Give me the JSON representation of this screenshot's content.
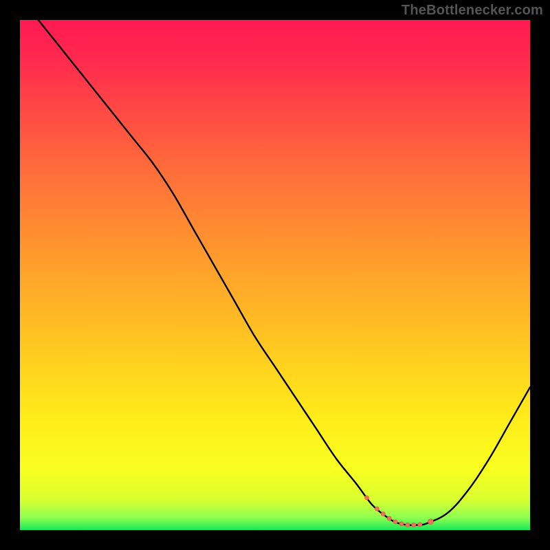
{
  "watermark": "TheBottlenecker.com",
  "colors": {
    "background": "#000000",
    "curve": "#000000",
    "marker_fill": "#f0735a",
    "marker_stroke": "#d85b45",
    "gradient_stops": [
      {
        "offset": 0.0,
        "color": "#ff1a52"
      },
      {
        "offset": 0.08,
        "color": "#ff2a4e"
      },
      {
        "offset": 0.18,
        "color": "#ff4a44"
      },
      {
        "offset": 0.3,
        "color": "#ff6e3a"
      },
      {
        "offset": 0.42,
        "color": "#ff8f30"
      },
      {
        "offset": 0.55,
        "color": "#ffb126"
      },
      {
        "offset": 0.68,
        "color": "#ffd31e"
      },
      {
        "offset": 0.78,
        "color": "#ffec1a"
      },
      {
        "offset": 0.88,
        "color": "#f9ff20"
      },
      {
        "offset": 0.94,
        "color": "#d9ff30"
      },
      {
        "offset": 0.976,
        "color": "#8dff50"
      },
      {
        "offset": 1.0,
        "color": "#16e858"
      }
    ]
  },
  "chart_data": {
    "type": "line",
    "title": "",
    "xlabel": "",
    "ylabel": "",
    "xlim": [
      0,
      100
    ],
    "ylim": [
      0,
      100
    ],
    "grid": false,
    "legend": false,
    "series": [
      {
        "name": "bottleneck-curve",
        "x": [
          2,
          6,
          10,
          14,
          18,
          22,
          26,
          30,
          34,
          38,
          42,
          46,
          50,
          54,
          58,
          62,
          66,
          69,
          72,
          74,
          76,
          78,
          80,
          84,
          88,
          92,
          96,
          100
        ],
        "y": [
          102,
          97,
          92,
          87,
          82,
          77,
          72,
          66,
          59,
          52,
          45,
          38,
          32,
          26,
          20,
          14,
          9,
          5,
          2.5,
          1.4,
          1.0,
          1.0,
          1.4,
          3.5,
          8,
          14,
          21,
          28
        ]
      }
    ],
    "markers": {
      "name": "bottleneck-band",
      "x": [
        68,
        70,
        71.2,
        72.4,
        73.6,
        74.8,
        76,
        77.2,
        78.4,
        80.5
      ],
      "r": [
        1.0,
        1.0,
        1.0,
        1.0,
        1.0,
        1.0,
        1.0,
        1.0,
        1.0,
        1.3
      ]
    }
  }
}
